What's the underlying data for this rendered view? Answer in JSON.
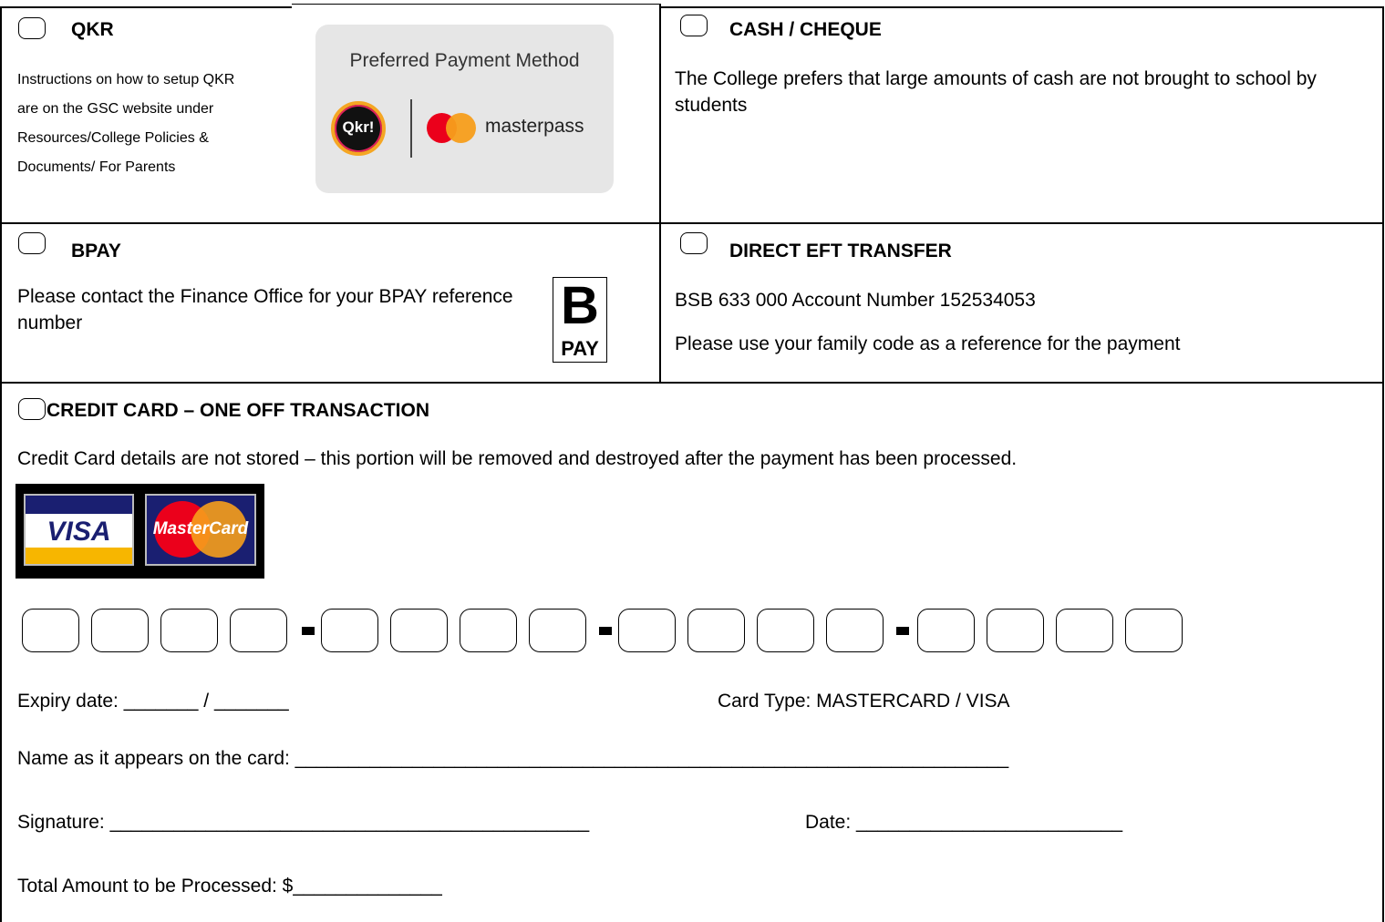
{
  "qkr": {
    "title": "QKR",
    "instructions": "Instructions on how to setup QKR are on the GSC website under Resources/College Policies & Documents/ For Parents",
    "badge_title": "Preferred Payment Method",
    "qkr_logo": "Qkr!",
    "masterpass_text": "masterpass"
  },
  "cash": {
    "title": "CASH / CHEQUE",
    "text": "The College prefers that large amounts of cash are not brought to school by students"
  },
  "bpay": {
    "title": "BPAY",
    "text": "Please contact the Finance Office for your BPAY reference number",
    "logo_letter": "B",
    "logo_text": "PAY"
  },
  "eft": {
    "title": "DIRECT EFT TRANSFER",
    "line1": "BSB 633 000 Account Number 152534053",
    "line2": "Please use your family code as a reference for the payment"
  },
  "credit": {
    "title": "CREDIT CARD – ONE OFF TRANSACTION",
    "notice": "Credit Card details are not stored – this portion will be removed and destroyed after the payment has been processed.",
    "visa_text": "VISA",
    "mastercard_text": "MasterCard",
    "expiry_label": "Expiry date: _______ / _______",
    "card_type_label": "Card Type:  MASTERCARD / VISA",
    "name_label": "Name as it appears on the card: ___________________________________________________________________",
    "signature_label": "Signature: _____________________________________________",
    "date_label": "Date: _________________________",
    "total_label": "Total Amount to be Processed: $______________"
  },
  "colors": {
    "border": "#000000",
    "badge_bg": "#e6e6e6",
    "mc_red": "#eb001b",
    "mc_yellow": "#f79e1b",
    "visa_blue": "#1a1f71",
    "visa_gold": "#f7b600"
  }
}
